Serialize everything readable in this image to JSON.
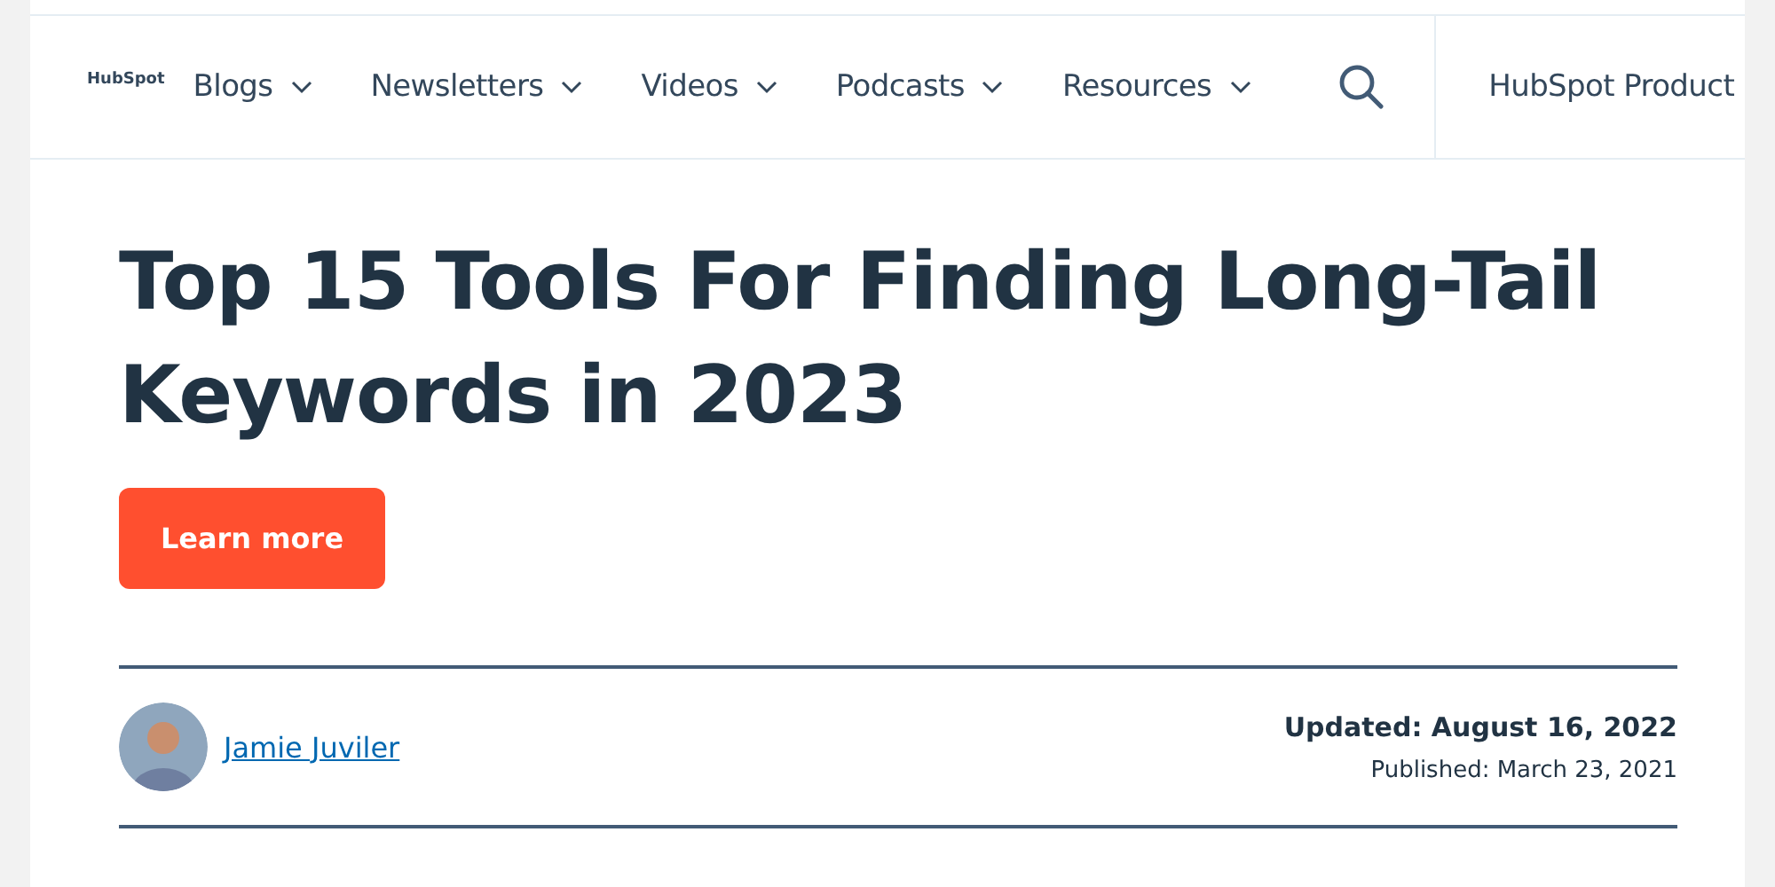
{
  "logo": {
    "text": "HubSpot"
  },
  "nav": [
    {
      "label": "Blogs"
    },
    {
      "label": "Newsletters"
    },
    {
      "label": "Videos"
    },
    {
      "label": "Podcasts"
    },
    {
      "label": "Resources"
    }
  ],
  "product_link": "HubSpot Product",
  "title": "Top 15 Tools For Finding Long-Tail Keywords in 2023",
  "cta": "Learn more",
  "author": {
    "name": "Jamie Juviler"
  },
  "updated": "Updated: August 16, 2022",
  "published": "Published: March 23, 2021"
}
